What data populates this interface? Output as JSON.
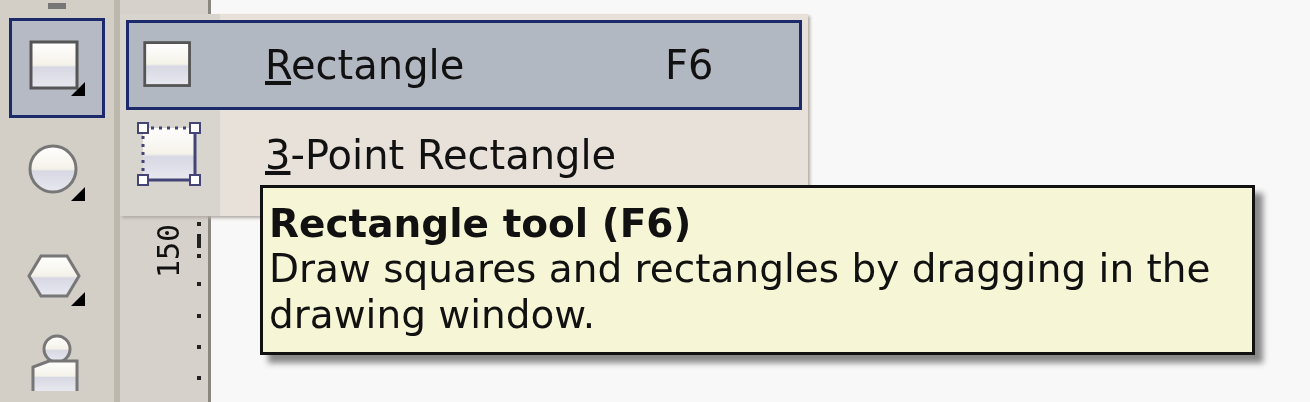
{
  "toolbox": {
    "tools": [
      {
        "kind": "top",
        "selected": false
      },
      {
        "kind": "rectangle",
        "selected": true
      },
      {
        "kind": "ellipse",
        "selected": false
      },
      {
        "kind": "polygon",
        "selected": false
      },
      {
        "kind": "shapes",
        "selected": false
      }
    ]
  },
  "ruler": {
    "label": "150"
  },
  "flyout": {
    "items": [
      {
        "kind": "rectangle",
        "label": "Rectangle",
        "shortcut": "F6",
        "selected": true
      },
      {
        "kind": "three-point",
        "label": "3-Point Rectangle",
        "selected": false
      }
    ]
  },
  "tooltip": {
    "title": "Rectangle tool (F6)",
    "description": "Draw squares and rectangles by dragging in the drawing window."
  }
}
